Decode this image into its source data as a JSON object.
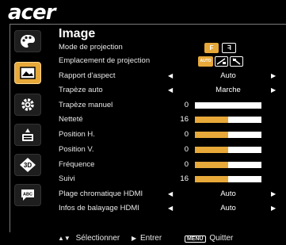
{
  "brand": "acer",
  "menu": {
    "title": "Image",
    "sidebar": [
      {
        "name": "color-palette-icon",
        "active": false
      },
      {
        "name": "image-icon",
        "active": true
      },
      {
        "name": "settings-gear-icon",
        "active": false
      },
      {
        "name": "management-icon",
        "active": false
      },
      {
        "name": "3d-icon",
        "active": false
      },
      {
        "name": "language-icon",
        "active": false
      }
    ],
    "rows": {
      "projection_mode": {
        "label": "Mode de projection",
        "opt1": "F",
        "opt2": "F"
      },
      "projection_location": {
        "label": "Emplacement de projection",
        "opt1": "AUTO"
      },
      "aspect_ratio": {
        "label": "Rapport d'aspect",
        "value": "Auto"
      },
      "auto_keystone": {
        "label": "Trapèze auto",
        "value": "Marche"
      },
      "manual_keystone": {
        "label": "Trapèze manuel",
        "value": "0",
        "level": 0.0
      },
      "sharpness": {
        "label": "Netteté",
        "value": "16",
        "level": 0.5
      },
      "h_position": {
        "label": "Position H.",
        "value": "0",
        "level": 0.5
      },
      "v_position": {
        "label": "Position V.",
        "value": "0",
        "level": 0.5
      },
      "frequency": {
        "label": "Fréquence",
        "value": "0",
        "level": 0.5
      },
      "tracking": {
        "label": "Suivi",
        "value": "16",
        "level": 0.5
      },
      "hdmi_color_range": {
        "label": "Plage chromatique HDMI",
        "value": "Auto"
      },
      "hdmi_scan_info": {
        "label": "Infos de balayage HDMI",
        "value": "Auto"
      }
    }
  },
  "footer": {
    "select": "Sélectionner",
    "enter": "Entrer",
    "menu_key": "MENU",
    "quit": "Quitter"
  },
  "colors": {
    "accent": "#e7a93a",
    "bar_bg": "#ffffff",
    "background": "#000000"
  }
}
